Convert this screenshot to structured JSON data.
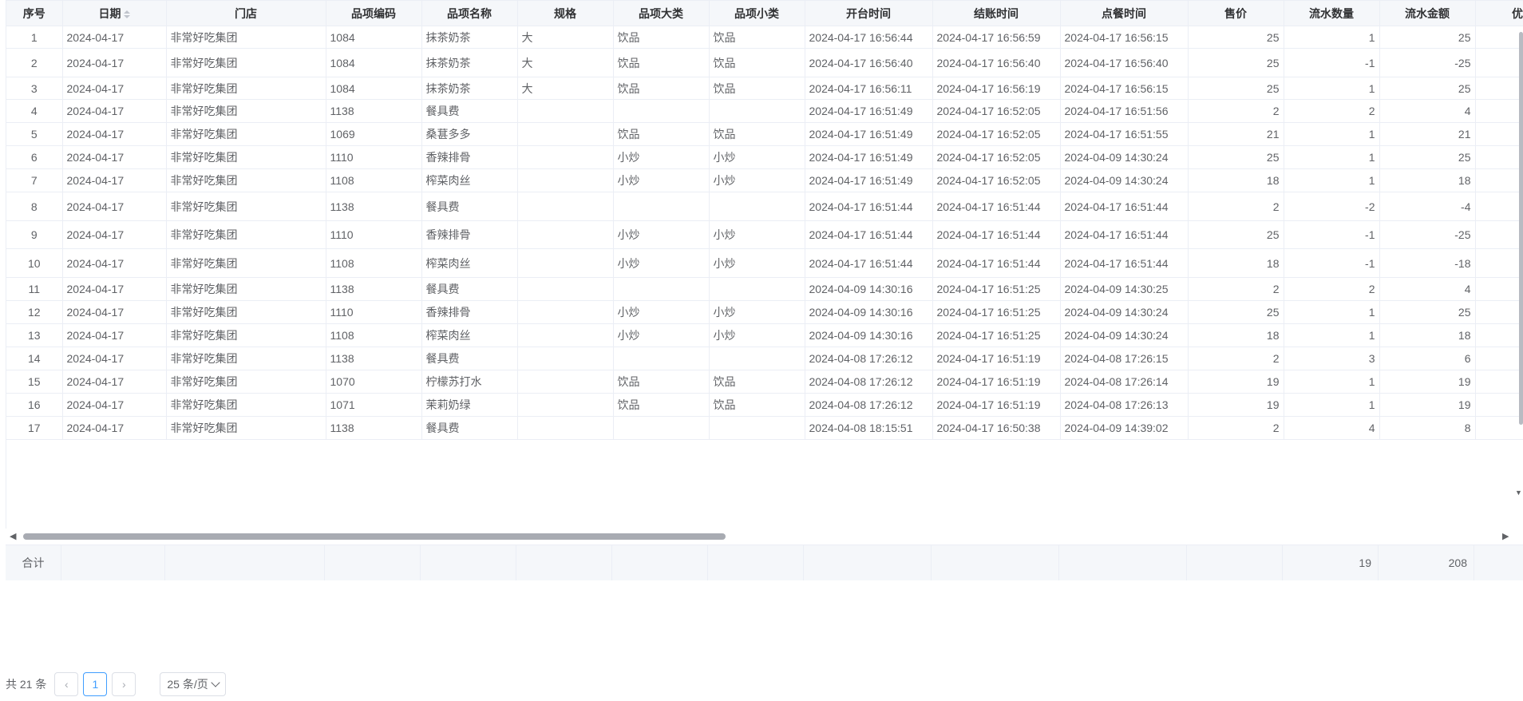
{
  "table": {
    "columns": [
      {
        "key": "seq",
        "label": "序号",
        "align": "center",
        "width": 70
      },
      {
        "key": "date",
        "label": "日期",
        "align": "left",
        "width": 130,
        "sortable": true
      },
      {
        "key": "store",
        "label": "门店",
        "align": "left",
        "width": 200
      },
      {
        "key": "code",
        "label": "品项编码",
        "align": "left",
        "width": 120
      },
      {
        "key": "name",
        "label": "品项名称",
        "align": "left",
        "width": 120
      },
      {
        "key": "spec",
        "label": "规格",
        "align": "left",
        "width": 120
      },
      {
        "key": "major",
        "label": "品项大类",
        "align": "left",
        "width": 120
      },
      {
        "key": "minor",
        "label": "品项小类",
        "align": "left",
        "width": 120
      },
      {
        "key": "open",
        "label": "开台时间",
        "align": "left",
        "width": 160
      },
      {
        "key": "checkout",
        "label": "结账时间",
        "align": "left",
        "width": 160
      },
      {
        "key": "order",
        "label": "点餐时间",
        "align": "left",
        "width": 160
      },
      {
        "key": "price",
        "label": "售价",
        "align": "right",
        "width": 120
      },
      {
        "key": "qty",
        "label": "流水数量",
        "align": "right",
        "width": 120
      },
      {
        "key": "amount",
        "label": "流水金额",
        "align": "right",
        "width": 120
      },
      {
        "key": "discount",
        "label": "优惠",
        "align": "right",
        "width": 120
      }
    ],
    "rows": [
      {
        "seq": "1",
        "date": "2024-04-17",
        "store": "非常好吃集团",
        "code": "1084",
        "name": "抹茶奶茶",
        "spec": "大",
        "major": "饮品",
        "minor": "饮品",
        "open": "2024-04-17 16:56:44",
        "checkout": "2024-04-17 16:56:59",
        "order": "2024-04-17 16:56:15",
        "price": "25",
        "qty": "1",
        "amount": "25",
        "discount": ""
      },
      {
        "seq": "2",
        "date": "2024-04-17",
        "store": "非常好吃集团",
        "code": "1084",
        "name": "抹茶奶茶",
        "spec": "大",
        "major": "饮品",
        "minor": "饮品",
        "open": "2024-04-17 16:56:40",
        "checkout": "2024-04-17 16:56:40",
        "order": "2024-04-17 16:56:40",
        "price": "25",
        "qty": "-1",
        "amount": "-25",
        "discount": ""
      },
      {
        "seq": "3",
        "date": "2024-04-17",
        "store": "非常好吃集团",
        "code": "1084",
        "name": "抹茶奶茶",
        "spec": "大",
        "major": "饮品",
        "minor": "饮品",
        "open": "2024-04-17 16:56:11",
        "checkout": "2024-04-17 16:56:19",
        "order": "2024-04-17 16:56:15",
        "price": "25",
        "qty": "1",
        "amount": "25",
        "discount": ""
      },
      {
        "seq": "4",
        "date": "2024-04-17",
        "store": "非常好吃集团",
        "code": "1138",
        "name": "餐具费",
        "spec": "",
        "major": "",
        "minor": "",
        "open": "2024-04-17 16:51:49",
        "checkout": "2024-04-17 16:52:05",
        "order": "2024-04-17 16:51:56",
        "price": "2",
        "qty": "2",
        "amount": "4",
        "discount": ""
      },
      {
        "seq": "5",
        "date": "2024-04-17",
        "store": "非常好吃集团",
        "code": "1069",
        "name": "桑葚多多",
        "spec": "",
        "major": "饮品",
        "minor": "饮品",
        "open": "2024-04-17 16:51:49",
        "checkout": "2024-04-17 16:52:05",
        "order": "2024-04-17 16:51:55",
        "price": "21",
        "qty": "1",
        "amount": "21",
        "discount": ""
      },
      {
        "seq": "6",
        "date": "2024-04-17",
        "store": "非常好吃集团",
        "code": "1110",
        "name": "香辣排骨",
        "spec": "",
        "major": "小炒",
        "minor": "小炒",
        "open": "2024-04-17 16:51:49",
        "checkout": "2024-04-17 16:52:05",
        "order": "2024-04-09 14:30:24",
        "price": "25",
        "qty": "1",
        "amount": "25",
        "discount": ""
      },
      {
        "seq": "7",
        "date": "2024-04-17",
        "store": "非常好吃集团",
        "code": "1108",
        "name": "榨菜肉丝",
        "spec": "",
        "major": "小炒",
        "minor": "小炒",
        "open": "2024-04-17 16:51:49",
        "checkout": "2024-04-17 16:52:05",
        "order": "2024-04-09 14:30:24",
        "price": "18",
        "qty": "1",
        "amount": "18",
        "discount": ""
      },
      {
        "seq": "8",
        "date": "2024-04-17",
        "store": "非常好吃集团",
        "code": "1138",
        "name": "餐具费",
        "spec": "",
        "major": "",
        "minor": "",
        "open": "2024-04-17 16:51:44",
        "checkout": "2024-04-17 16:51:44",
        "order": "2024-04-17 16:51:44",
        "price": "2",
        "qty": "-2",
        "amount": "-4",
        "discount": ""
      },
      {
        "seq": "9",
        "date": "2024-04-17",
        "store": "非常好吃集团",
        "code": "1110",
        "name": "香辣排骨",
        "spec": "",
        "major": "小炒",
        "minor": "小炒",
        "open": "2024-04-17 16:51:44",
        "checkout": "2024-04-17 16:51:44",
        "order": "2024-04-17 16:51:44",
        "price": "25",
        "qty": "-1",
        "amount": "-25",
        "discount": ""
      },
      {
        "seq": "10",
        "date": "2024-04-17",
        "store": "非常好吃集团",
        "code": "1108",
        "name": "榨菜肉丝",
        "spec": "",
        "major": "小炒",
        "minor": "小炒",
        "open": "2024-04-17 16:51:44",
        "checkout": "2024-04-17 16:51:44",
        "order": "2024-04-17 16:51:44",
        "price": "18",
        "qty": "-1",
        "amount": "-18",
        "discount": ""
      },
      {
        "seq": "11",
        "date": "2024-04-17",
        "store": "非常好吃集团",
        "code": "1138",
        "name": "餐具费",
        "spec": "",
        "major": "",
        "minor": "",
        "open": "2024-04-09 14:30:16",
        "checkout": "2024-04-17 16:51:25",
        "order": "2024-04-09 14:30:25",
        "price": "2",
        "qty": "2",
        "amount": "4",
        "discount": ""
      },
      {
        "seq": "12",
        "date": "2024-04-17",
        "store": "非常好吃集团",
        "code": "1110",
        "name": "香辣排骨",
        "spec": "",
        "major": "小炒",
        "minor": "小炒",
        "open": "2024-04-09 14:30:16",
        "checkout": "2024-04-17 16:51:25",
        "order": "2024-04-09 14:30:24",
        "price": "25",
        "qty": "1",
        "amount": "25",
        "discount": ""
      },
      {
        "seq": "13",
        "date": "2024-04-17",
        "store": "非常好吃集团",
        "code": "1108",
        "name": "榨菜肉丝",
        "spec": "",
        "major": "小炒",
        "minor": "小炒",
        "open": "2024-04-09 14:30:16",
        "checkout": "2024-04-17 16:51:25",
        "order": "2024-04-09 14:30:24",
        "price": "18",
        "qty": "1",
        "amount": "18",
        "discount": ""
      },
      {
        "seq": "14",
        "date": "2024-04-17",
        "store": "非常好吃集团",
        "code": "1138",
        "name": "餐具费",
        "spec": "",
        "major": "",
        "minor": "",
        "open": "2024-04-08 17:26:12",
        "checkout": "2024-04-17 16:51:19",
        "order": "2024-04-08 17:26:15",
        "price": "2",
        "qty": "3",
        "amount": "6",
        "discount": ""
      },
      {
        "seq": "15",
        "date": "2024-04-17",
        "store": "非常好吃集团",
        "code": "1070",
        "name": "柠檬苏打水",
        "spec": "",
        "major": "饮品",
        "minor": "饮品",
        "open": "2024-04-08 17:26:12",
        "checkout": "2024-04-17 16:51:19",
        "order": "2024-04-08 17:26:14",
        "price": "19",
        "qty": "1",
        "amount": "19",
        "discount": ""
      },
      {
        "seq": "16",
        "date": "2024-04-17",
        "store": "非常好吃集团",
        "code": "1071",
        "name": "茉莉奶绿",
        "spec": "",
        "major": "饮品",
        "minor": "饮品",
        "open": "2024-04-08 17:26:12",
        "checkout": "2024-04-17 16:51:19",
        "order": "2024-04-08 17:26:13",
        "price": "19",
        "qty": "1",
        "amount": "19",
        "discount": ""
      },
      {
        "seq": "17",
        "date": "2024-04-17",
        "store": "非常好吃集团",
        "code": "1138",
        "name": "餐具费",
        "spec": "",
        "major": "",
        "minor": "",
        "open": "2024-04-08 18:15:51",
        "checkout": "2024-04-17 16:50:38",
        "order": "2024-04-09 14:39:02",
        "price": "2",
        "qty": "4",
        "amount": "8",
        "discount": ""
      }
    ],
    "footer": {
      "label": "合计",
      "qty": "19",
      "amount": "208"
    }
  },
  "pagination": {
    "total_text": "共 21 条",
    "prev_icon": "chevron-left-icon",
    "current_page": "1",
    "next_icon": "chevron-right-icon",
    "page_size_text": "25 条/页"
  },
  "colors": {
    "accent": "#409eff",
    "border": "#ebeef5",
    "header_bg": "#f5f7fa",
    "text": "#606266"
  }
}
